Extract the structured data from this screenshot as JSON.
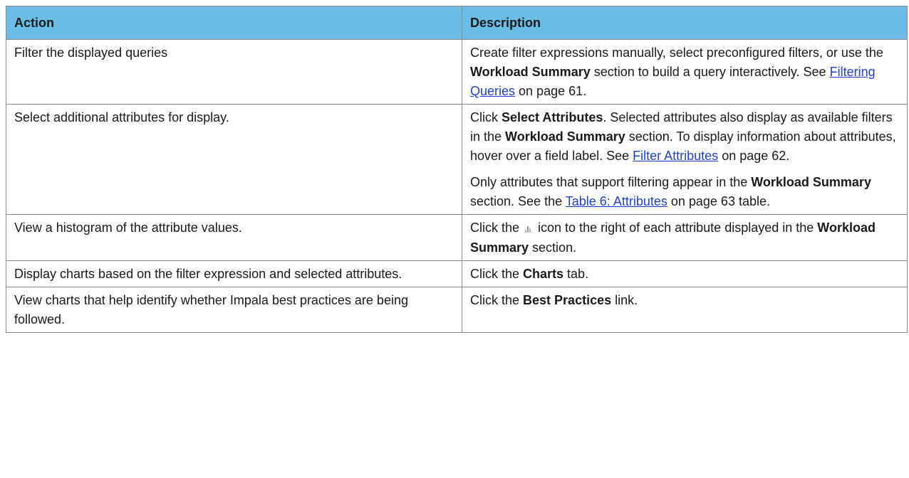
{
  "header": {
    "action": "Action",
    "description": "Description"
  },
  "rows": [
    {
      "action": "Filter the displayed queries",
      "description": {
        "t1": "Create filter expressions manually, select preconfigured filters, or use the ",
        "b1": "Workload Summary",
        "t2": " section to build a query interactively. See ",
        "link": "Filtering Queries",
        "t3": " on page 61."
      }
    },
    {
      "action": "Select additional attributes for display.",
      "description": {
        "p1": {
          "b1": "Select Attributes",
          "t1": ". Selected attributes also display as available filters in the ",
          "b2": "Workload Summary",
          "t2": " section. To display information about attributes, hover over a field label. See ",
          "link": "Filter Attributes",
          "t3": " on page 62.",
          "lead": "Click "
        },
        "p2": {
          "t1": "Only attributes that support filtering appear in the ",
          "b1": "Workload Summary",
          "t2": " section. See the ",
          "link": "Table 6: Attributes",
          "t3": " on page 63 table."
        }
      }
    },
    {
      "action": "View a histogram of the attribute values.",
      "description": {
        "t1": "Click the ",
        "icon": "histogram-icon",
        "t2": " icon to the right of each attribute displayed in the ",
        "b1": "Workload Summary",
        "t3": " section."
      }
    },
    {
      "action": "Display charts based on the filter expression and selected attributes.",
      "description": {
        "t1": "Click the ",
        "b1": "Charts",
        "t2": " tab."
      }
    },
    {
      "action": "View charts that help identify whether Impala best practices are being followed.",
      "description": {
        "t1": "Click the ",
        "b1": "Best Practices",
        "t2": " link."
      }
    }
  ],
  "colors": {
    "header_bg": "#6bbde6",
    "link": "#1d3fd6",
    "border": "#8a8a8a"
  }
}
